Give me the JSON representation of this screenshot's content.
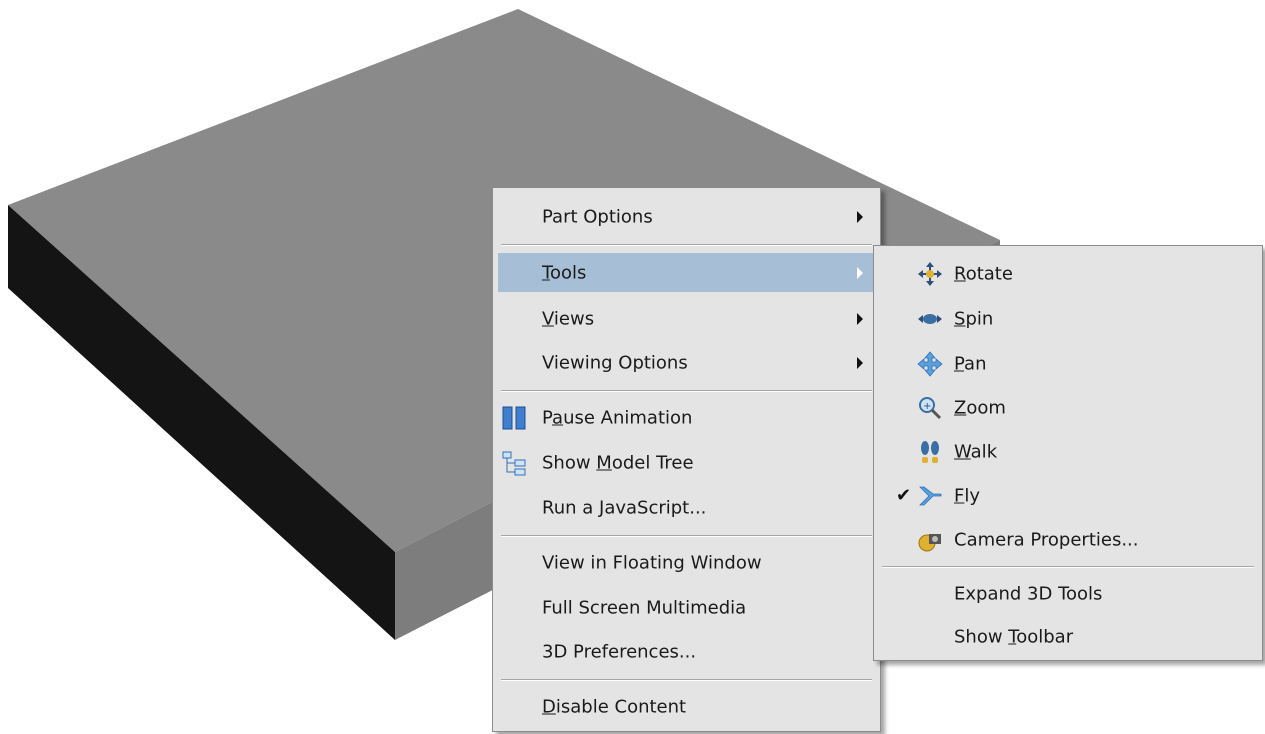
{
  "colors": {
    "menu_bg": "#e4e4e4",
    "highlight": "#a7bfd6",
    "box_top": "#8a8a8a",
    "box_front": "#7d7d7d",
    "box_side": "#111111"
  },
  "main_menu": {
    "part_options": {
      "pre": "Part Options",
      "key": "",
      "post": ""
    },
    "tools": {
      "pre": "",
      "key": "T",
      "post": "ools"
    },
    "views": {
      "pre": "",
      "key": "V",
      "post": "iews"
    },
    "viewing_options": {
      "pre": "Viewing Options",
      "key": "",
      "post": ""
    },
    "pause_animation": {
      "pre": "P",
      "key": "a",
      "post": "use Animation"
    },
    "show_model_tree": {
      "pre": "Show ",
      "key": "M",
      "post": "odel Tree"
    },
    "run_javascript": {
      "pre": "Run a ",
      "key": "J",
      "post": "avaScript..."
    },
    "view_floating": {
      "pre": "View in Floating Window",
      "key": "",
      "post": ""
    },
    "full_screen": {
      "pre": "Full Screen Multimedia",
      "key": "",
      "post": ""
    },
    "preferences_3d": {
      "pre": "3D Preferences...",
      "key": "",
      "post": ""
    },
    "disable_content": {
      "pre": "",
      "key": "D",
      "post": "isable Content"
    }
  },
  "tools_submenu": {
    "rotate": {
      "pre": "",
      "key": "R",
      "post": "otate"
    },
    "spin": {
      "pre": "",
      "key": "S",
      "post": "pin"
    },
    "pan": {
      "pre": "",
      "key": "P",
      "post": "an"
    },
    "zoom": {
      "pre": "",
      "key": "Z",
      "post": "oom"
    },
    "walk": {
      "pre": "",
      "key": "W",
      "post": "alk"
    },
    "fly": {
      "pre": "",
      "key": "F",
      "post": "ly",
      "checked": true,
      "check_mark": "✔"
    },
    "camera_properties": {
      "pre": "Camera Properties...",
      "key": "",
      "post": ""
    },
    "expand_3d_tools": {
      "pre": "Expand 3D Tools",
      "key": "",
      "post": ""
    },
    "show_toolbar": {
      "pre": "Show ",
      "key": "T",
      "post": "oolbar"
    }
  },
  "icons": {
    "pause_animation": "pause-icon",
    "show_model_tree": "model-tree-icon",
    "rotate": "rotate-icon",
    "spin": "spin-icon",
    "pan": "pan-icon",
    "zoom": "zoom-icon",
    "walk": "walk-icon",
    "fly": "fly-icon",
    "camera_properties": "camera-properties-icon"
  }
}
